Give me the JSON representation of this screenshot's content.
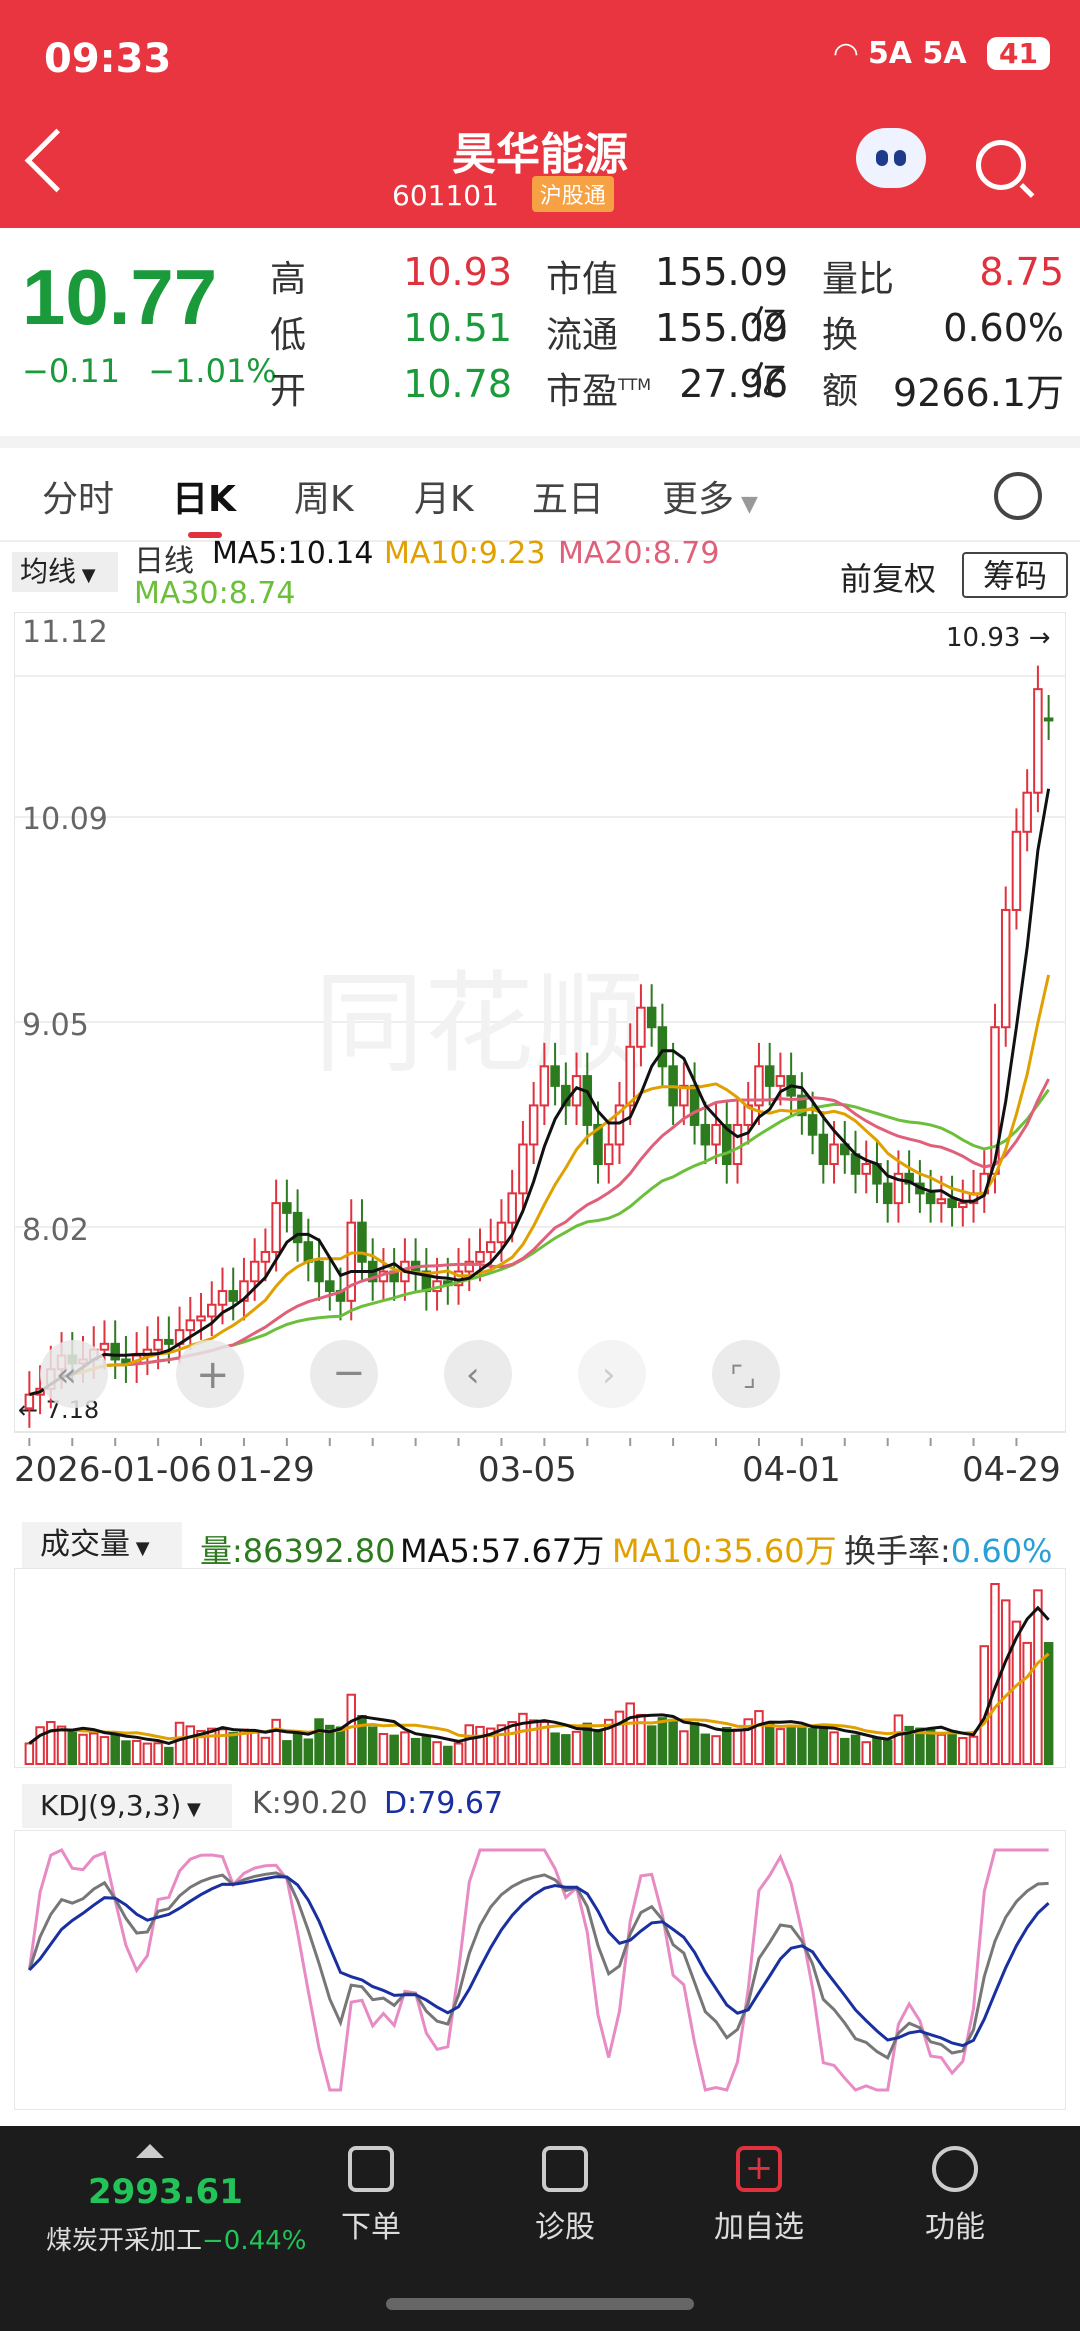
{
  "status": {
    "time": "09:33",
    "network": "5A 5A",
    "battery": "41"
  },
  "header": {
    "title": "昊华能源",
    "code": "601101",
    "tag": "沪股通"
  },
  "quote": {
    "price": "10.77",
    "change": "−0.11",
    "change_pct": "−1.01%",
    "high_label": "高",
    "high": "10.93",
    "low_label": "低",
    "low": "10.51",
    "open_label": "开",
    "open": "10.78",
    "mcap_label": "市值",
    "mcap": "155.09亿",
    "float_label": "流通",
    "float": "155.09亿",
    "pe_label": "市盈",
    "pe_sup": "TTM",
    "pe": "27.96",
    "vr_label": "量比",
    "vr": "8.75",
    "turnover_label": "换",
    "turnover": "0.60%",
    "amount_label": "额",
    "amount": "9266.1万"
  },
  "tabs": [
    "分时",
    "日K",
    "周K",
    "月K",
    "五日",
    "更多"
  ],
  "active_tab": "日K",
  "ma_legend": {
    "dropdown": "均线",
    "period": "日线",
    "ma5": "MA5:10.14",
    "ma10": "MA10:9.23",
    "ma20": "MA20:8.79",
    "ma30": "MA30:8.74",
    "fuquan": "前复权",
    "chouma": "筹码"
  },
  "kline": {
    "y_ticks": [
      "11.12",
      "10.09",
      "9.05",
      "8.02"
    ],
    "high_marker": "10.93",
    "low_marker": "7.18",
    "dates": [
      "2026-01-06",
      "01-29",
      "03-05",
      "04-01",
      "04-29"
    ]
  },
  "volume_legend": {
    "dropdown": "成交量",
    "vol": "量:86392.80",
    "ma5": "MA5:57.67万",
    "ma10": "MA10:35.60万",
    "turnover_label": "换手率:",
    "turnover": "0.60%"
  },
  "kdj_legend": {
    "dropdown": "KDJ(9,3,3)",
    "k": "K:90.20",
    "d": "D:79.67"
  },
  "bottom_nav": {
    "index_value": "2993.61",
    "index_name": "煤炭开采加工",
    "index_pct": "−0.44%",
    "items": [
      "下单",
      "诊股",
      "加自选",
      "功能"
    ]
  },
  "colors": {
    "header": "#e8353f",
    "up": "#e0323e",
    "down": "#2d7a1f",
    "ma5": "#111111",
    "ma10": "#e0a000",
    "ma20": "#e0607a",
    "ma30": "#6cbf3a"
  },
  "chart_data": {
    "type": "candlestick",
    "closes": [
      7.32,
      7.35,
      7.45,
      7.52,
      7.48,
      7.5,
      7.55,
      7.58,
      7.5,
      7.48,
      7.52,
      7.55,
      7.6,
      7.58,
      7.65,
      7.7,
      7.72,
      7.78,
      7.85,
      7.8,
      7.9,
      8.0,
      8.05,
      8.3,
      8.25,
      8.1,
      8.0,
      7.9,
      7.85,
      7.8,
      8.2,
      8.0,
      7.9,
      7.95,
      7.9,
      8.0,
      7.95,
      7.85,
      7.9,
      7.88,
      7.95,
      8.0,
      8.05,
      8.1,
      8.2,
      8.35,
      8.6,
      8.8,
      9.0,
      8.9,
      8.8,
      8.95,
      8.7,
      8.5,
      8.6,
      8.8,
      9.1,
      9.3,
      9.2,
      9.0,
      8.8,
      8.9,
      8.7,
      8.6,
      8.7,
      8.5,
      8.7,
      8.8,
      9.0,
      8.9,
      8.95,
      8.85,
      8.75,
      8.65,
      8.5,
      8.6,
      8.55,
      8.45,
      8.5,
      8.4,
      8.3,
      8.45,
      8.4,
      8.35,
      8.3,
      8.32,
      8.28,
      8.3,
      8.35,
      8.45,
      9.2,
      9.8,
      10.2,
      10.4,
      10.93,
      10.77
    ],
    "opens": [
      7.25,
      7.32,
      7.35,
      7.45,
      7.52,
      7.48,
      7.5,
      7.55,
      7.58,
      7.5,
      7.48,
      7.52,
      7.55,
      7.6,
      7.58,
      7.65,
      7.7,
      7.72,
      7.78,
      7.85,
      7.8,
      7.9,
      8.0,
      8.05,
      8.3,
      8.25,
      8.1,
      8.0,
      7.9,
      7.85,
      7.8,
      8.2,
      8.0,
      7.9,
      7.95,
      7.9,
      8.0,
      7.95,
      7.85,
      7.9,
      7.88,
      7.95,
      8.0,
      8.05,
      8.1,
      8.2,
      8.35,
      8.6,
      8.8,
      9.0,
      8.9,
      8.8,
      8.95,
      8.7,
      8.5,
      8.6,
      8.8,
      9.1,
      9.3,
      9.2,
      9.0,
      8.8,
      8.9,
      8.7,
      8.6,
      8.7,
      8.5,
      8.7,
      8.8,
      9.0,
      8.9,
      8.95,
      8.85,
      8.75,
      8.65,
      8.5,
      8.6,
      8.55,
      8.45,
      8.5,
      8.4,
      8.3,
      8.45,
      8.4,
      8.35,
      8.3,
      8.32,
      8.28,
      8.3,
      8.35,
      8.45,
      9.2,
      9.8,
      10.2,
      10.4,
      10.78
    ],
    "ma5_last": 10.14,
    "ma10_last": 9.23,
    "ma20_last": 8.79,
    "ma30_last": 8.74,
    "kline_ylim": [
      7.18,
      11.12
    ],
    "volume_ma5": 57.67,
    "volume_ma10": 35.6,
    "kdj_last": {
      "K": 90.2,
      "D": 79.67
    }
  }
}
